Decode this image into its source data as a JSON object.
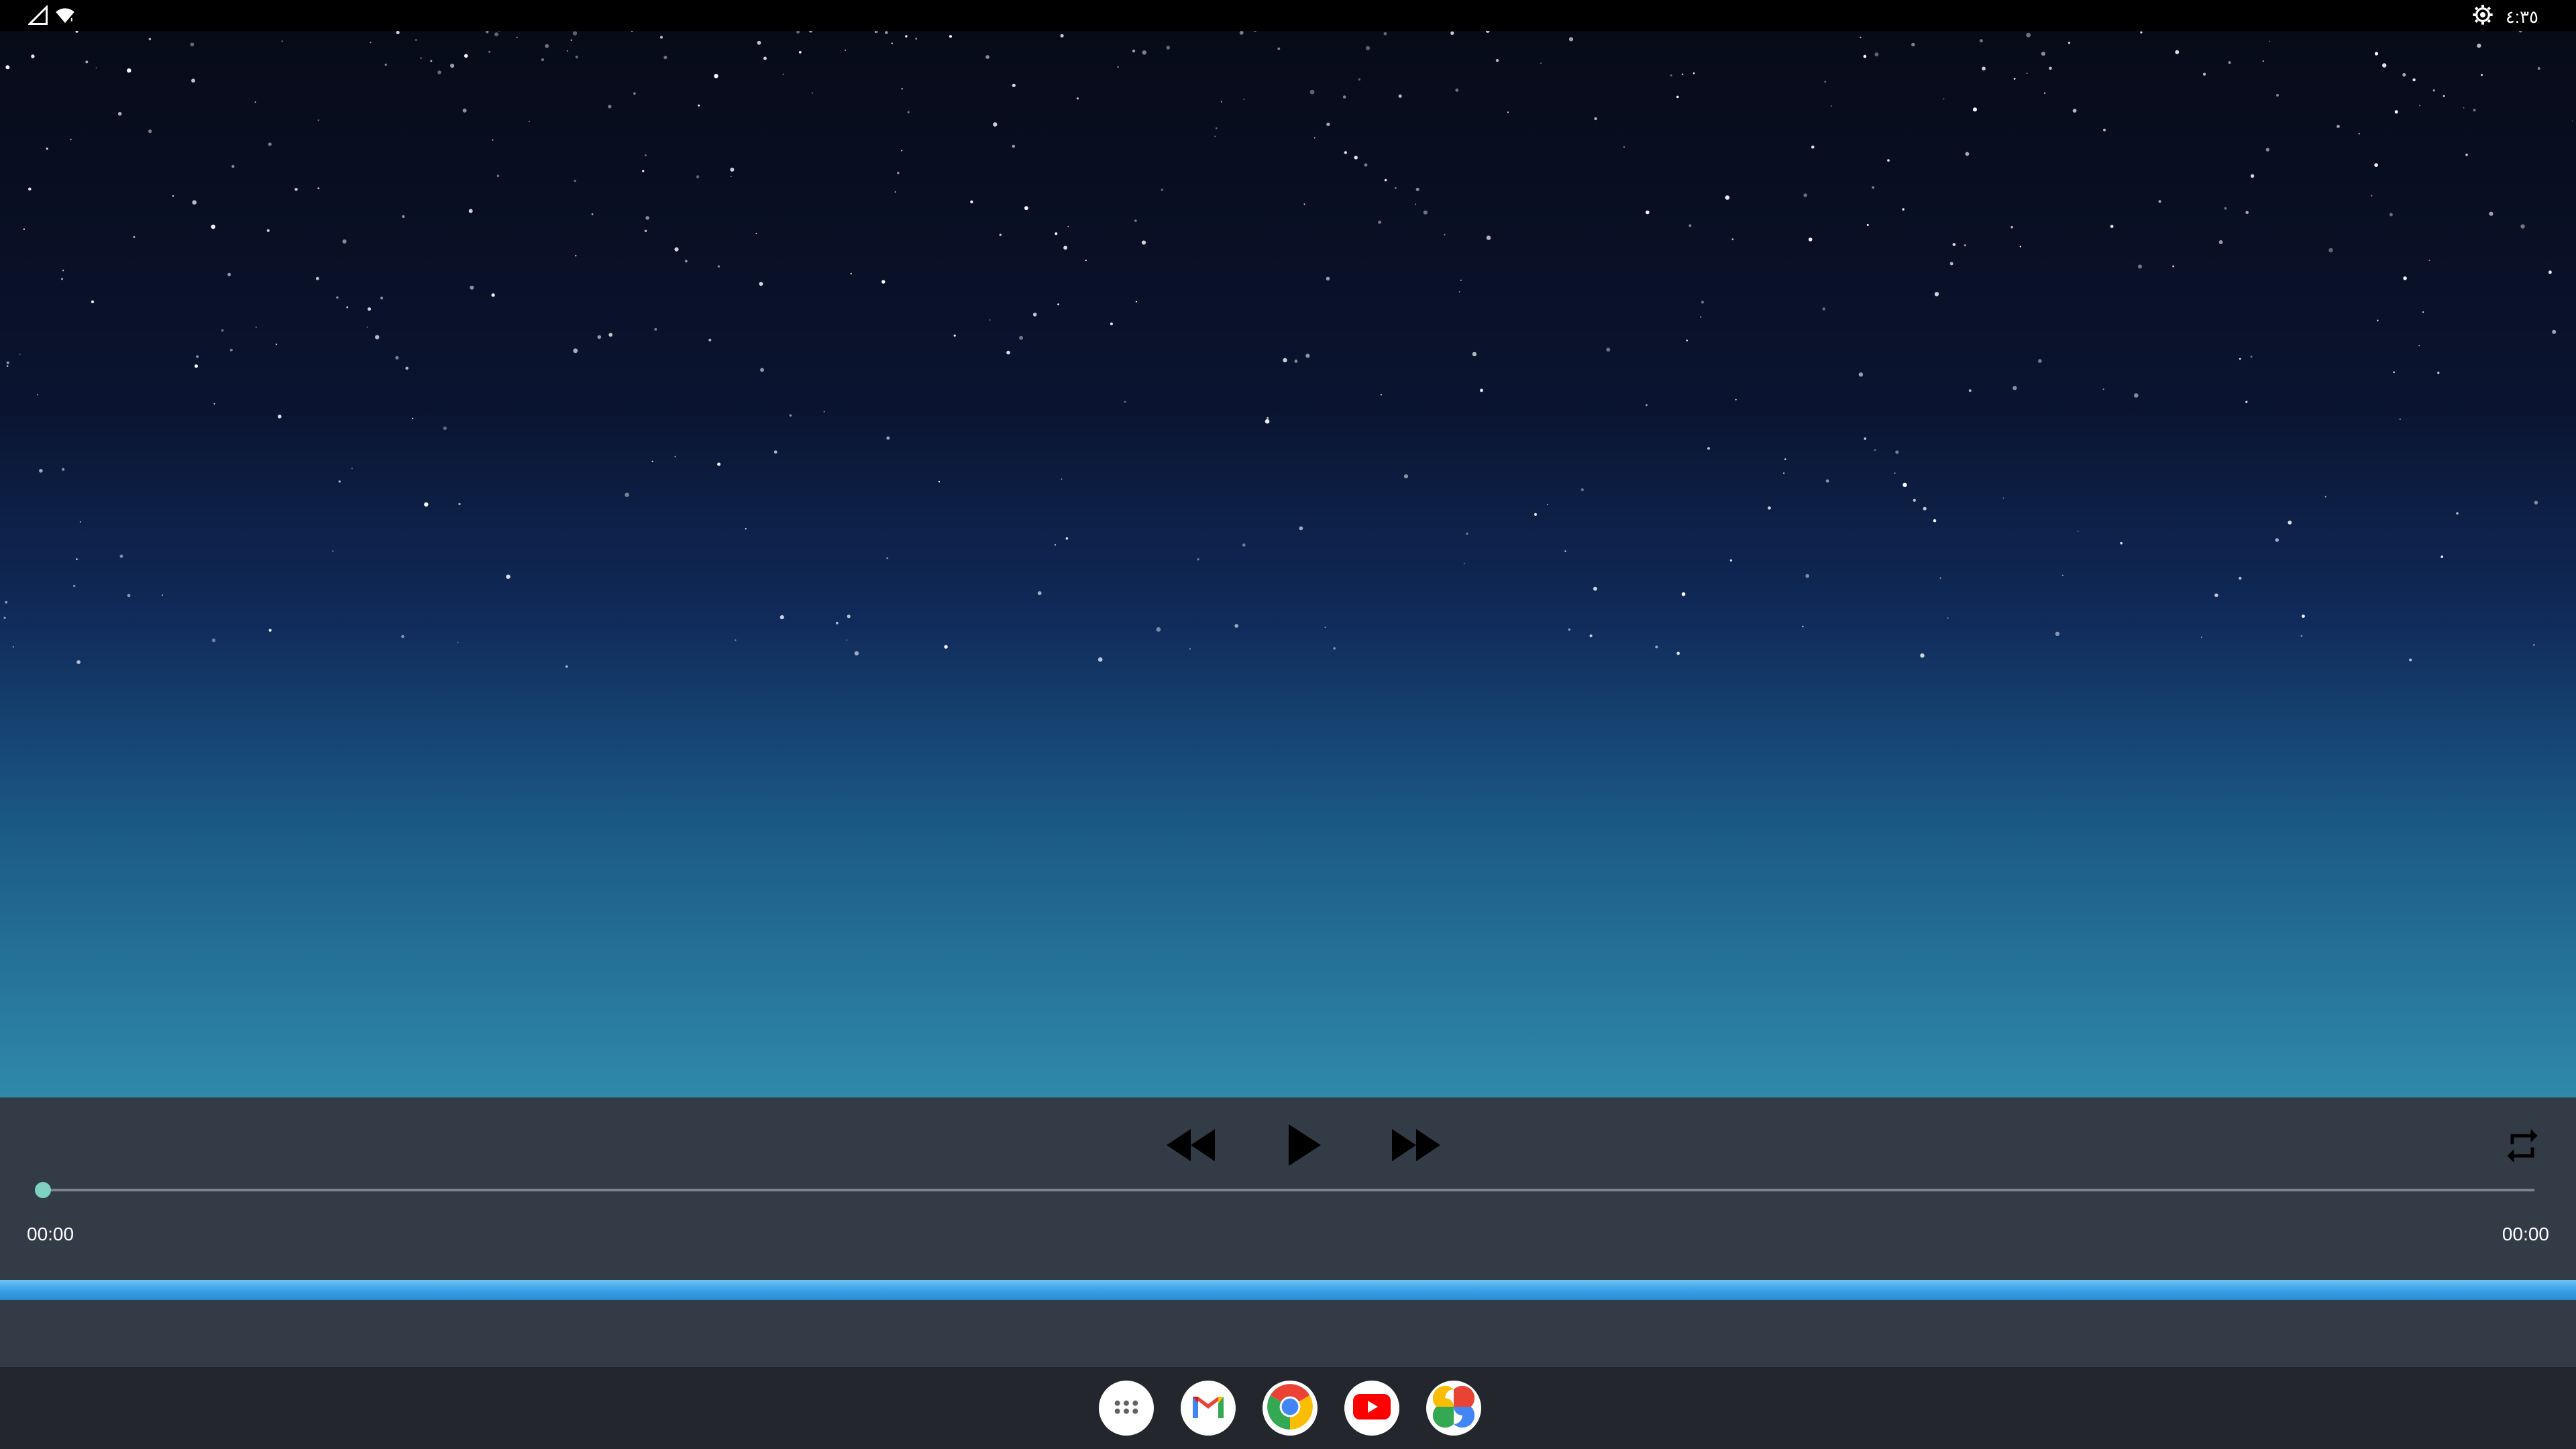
{
  "status_bar": {
    "time": "٤:٣٥",
    "icons": [
      "signal-icon",
      "wifi-icon",
      "settings-icon"
    ]
  },
  "media": {
    "background": "starry night sky wallpaper"
  },
  "player": {
    "elapsed_time": "00:00",
    "total_time": "00:00",
    "progress_fraction": 0,
    "buttons": [
      "rewind-icon",
      "play-icon",
      "fast-forward-icon",
      "repeat-icon"
    ],
    "accent_color": "#7fd1c0"
  },
  "taskbar": {
    "apps": [
      {
        "name": "app-launcher-icon"
      },
      {
        "name": "gmail-icon"
      },
      {
        "name": "chrome-icon"
      },
      {
        "name": "youtube-icon"
      },
      {
        "name": "google-photos-icon"
      }
    ]
  },
  "colors": {
    "panel": "#333b47",
    "progress_strip": "#3aa2e8",
    "taskbar": "#23262c"
  }
}
